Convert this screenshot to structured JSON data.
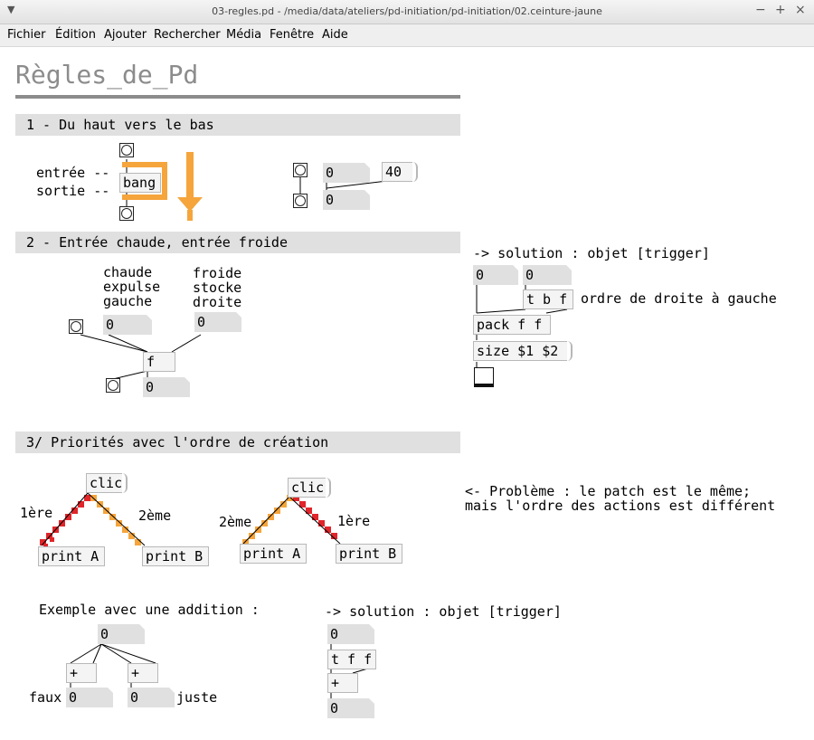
{
  "window": {
    "title": "03-regles.pd  - /media/data/ateliers/pd-initiation/pd-initiation/02.ceinture-jaune",
    "buttons": {
      "minimize": "−",
      "maximize": "+",
      "close": "×"
    }
  },
  "menu": {
    "items": [
      "Fichier",
      "Édition",
      "Ajouter",
      "Rechercher",
      "Média",
      "Fenêtre",
      "Aide"
    ]
  },
  "patch": {
    "heading": "Règles_de_Pd",
    "sections": {
      "s1": "1 - Du haut vers le bas",
      "s2": "2 - Entrée chaude, entrée froide",
      "s3": "3/ Priorités avec l'ordre de création"
    },
    "part1": {
      "entree": "entrée --",
      "sortie": "sortie --",
      "bang": "bang",
      "num_a": "0",
      "num_b": "0",
      "msg_40": "40"
    },
    "part2": {
      "chaude": "chaude\nexpulse\ngauche",
      "froide": "froide\nstocke\ndroite",
      "num_left": "0",
      "num_right": "0",
      "obj_f": "f",
      "num_out": "0",
      "solution": "-> solution : objet [trigger]",
      "sol_num_left": "0",
      "sol_num_right": "0",
      "sol_tbf": "t b f",
      "sol_order": "ordre de droite à gauche",
      "sol_pack": "pack f f",
      "sol_size": "size $1 $2"
    },
    "part3": {
      "clic_left": "clic",
      "clic_right": "clic",
      "premiere_left": "1ère",
      "deuxieme_left": "2ème",
      "deuxieme_right": "2ème",
      "premiere_right": "1ère",
      "print_a_left": "print A",
      "print_b_left": "print B",
      "print_a_right": "print A",
      "print_b_right": "print B",
      "probleme": "<- Problème : le patch est le même;\nmais l'ordre des actions est différent",
      "exemple": "Exemple avec une addition :",
      "ex_num_top": "0",
      "ex_plus_left": "+",
      "ex_plus_right": "+",
      "faux": "faux",
      "juste": "juste",
      "ex_num_left": "0",
      "ex_num_right": "0",
      "solution2": "-> solution : objet [trigger]",
      "sol2_num_top": "0",
      "sol2_tff": "t f f",
      "sol2_plus": "+",
      "sol2_num_out": "0"
    }
  },
  "colors": {
    "orange": "#f5a53c",
    "red": "#e0252b",
    "section_bg": "#e0e0e0",
    "heading": "#8c8c8c"
  }
}
